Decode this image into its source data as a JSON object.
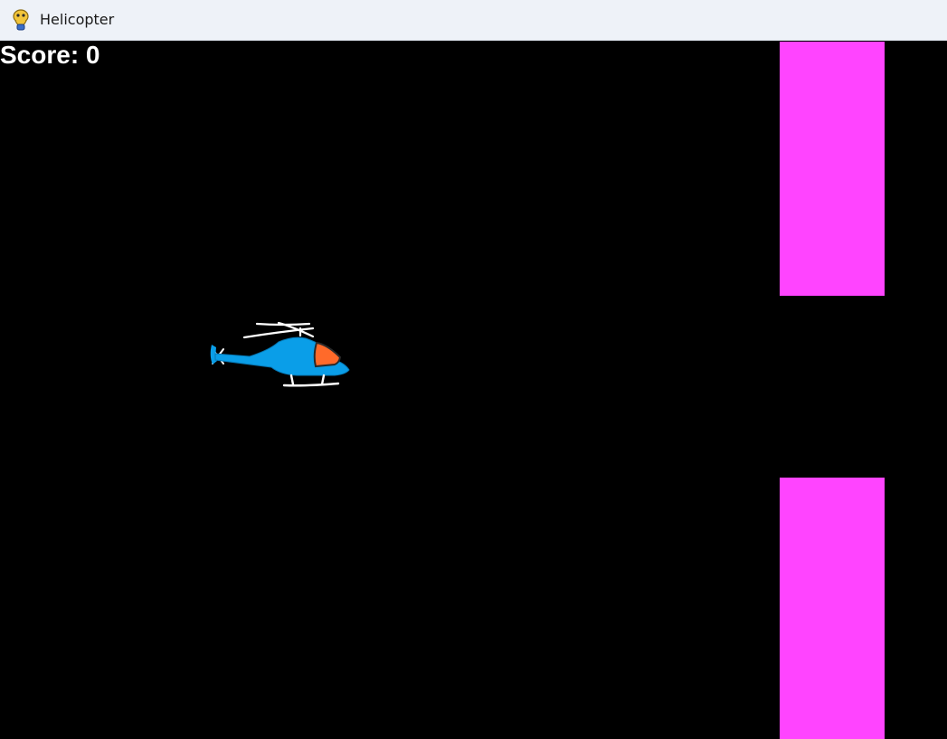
{
  "window": {
    "title": "Helicopter",
    "icon": "pygame-snake-icon"
  },
  "game": {
    "score_text": "Score: 0",
    "score": 0,
    "colors": {
      "background": "#000000",
      "obstacle": "#ff44ff",
      "helicopter_body": "#0a9ee8",
      "helicopter_cockpit": "#ff6a2a",
      "score_text": "#ffffff"
    },
    "sprites": {
      "player": "helicopter",
      "obstacles": [
        "obstacle-top-pillar",
        "obstacle-bottom-pillar"
      ]
    }
  }
}
